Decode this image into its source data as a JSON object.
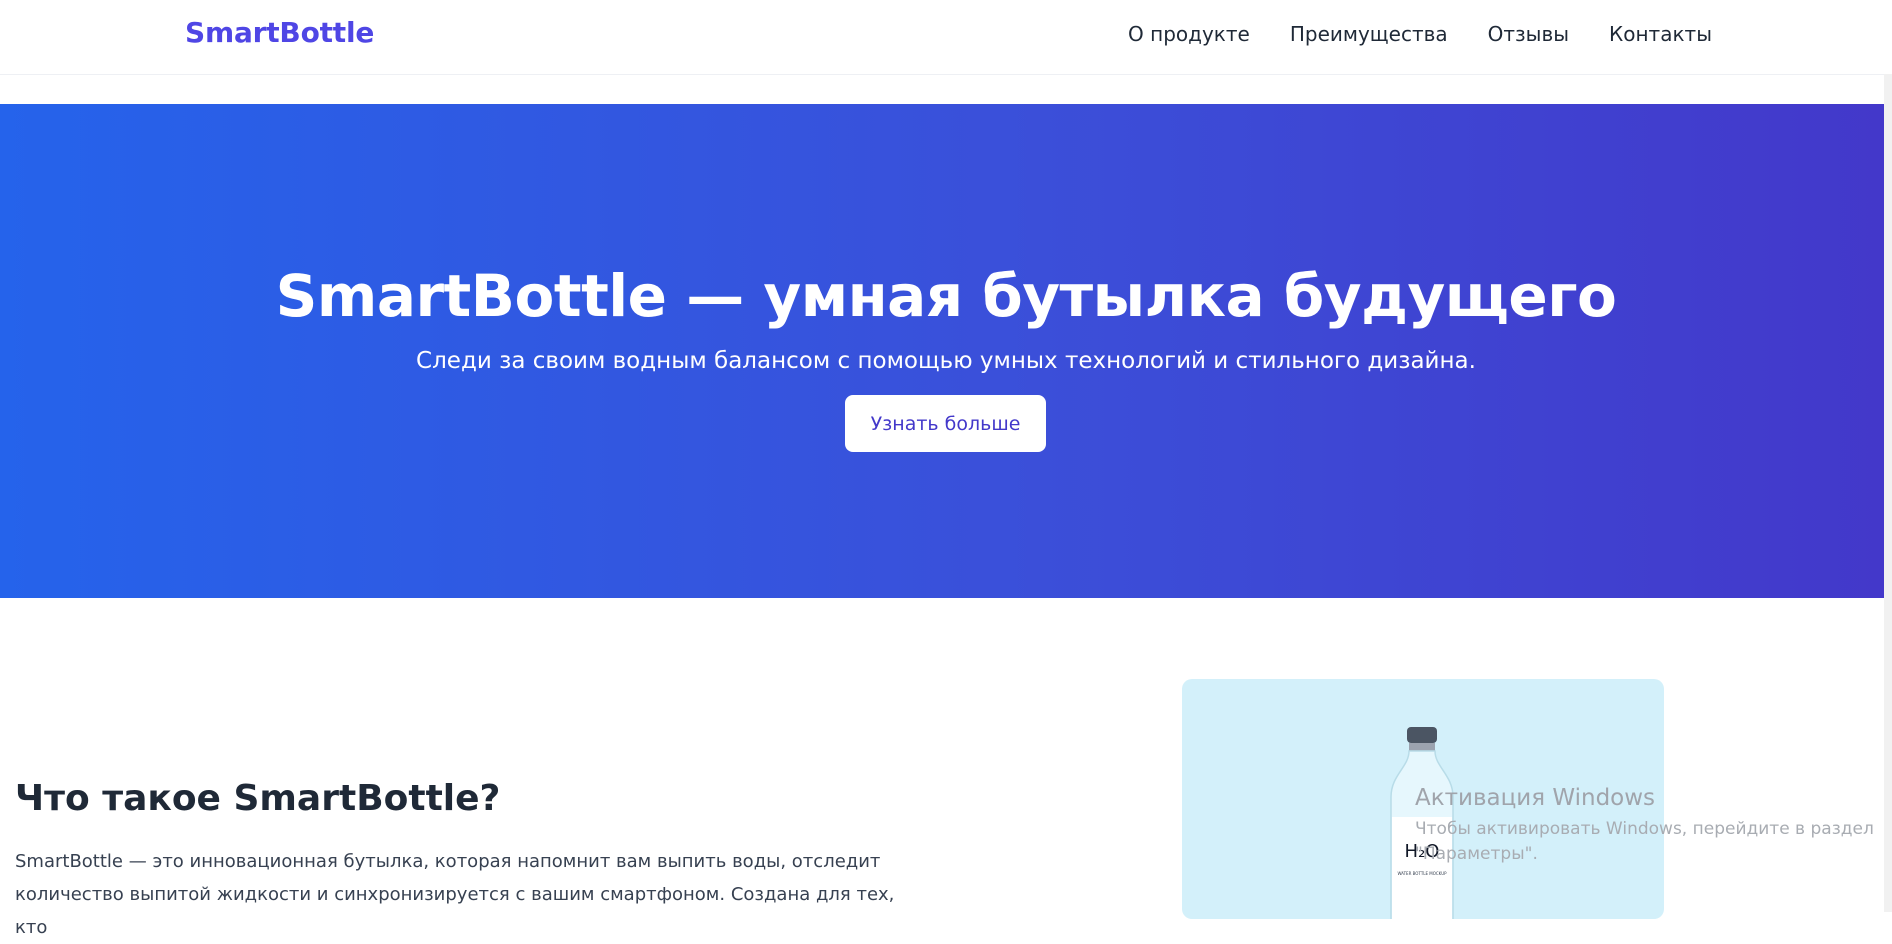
{
  "header": {
    "brand": "SmartBottle",
    "nav": [
      "О продукте",
      "Преимущества",
      "Отзывы",
      "Контакты"
    ]
  },
  "hero": {
    "title": "SmartBottle — умная бутылка будущего",
    "subtitle": "Следи за своим водным балансом с помощью умных технологий и стильного дизайна.",
    "button_label": "Узнать больше"
  },
  "about": {
    "title": "Что такое SmartBottle?",
    "text": "SmartBottle — это инновационная бутылка, которая напомнит вам выпить воды, отследит количество выпитой жидкости и синхронизируется с вашим смартфоном. Создана для тех, кто"
  },
  "product_image": {
    "label_main": "H₂O",
    "label_sub": "WATER BOTTLE MOCKUP"
  },
  "watermark": {
    "title": "Активация Windows",
    "text": "Чтобы активировать Windows, перейдите в раздел \"Параметры\"."
  },
  "colors": {
    "brand": "#4f46e5",
    "hero_gradient_start": "#2563eb",
    "hero_gradient_end": "#4338ca",
    "card_background": "#d3f0fa"
  }
}
